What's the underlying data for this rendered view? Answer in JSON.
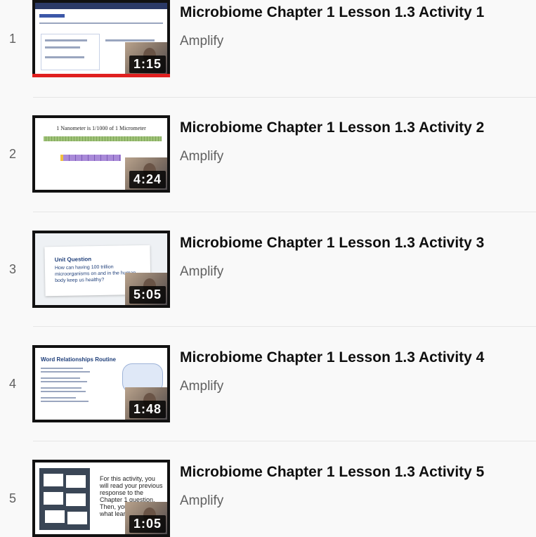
{
  "playlist": {
    "items": [
      {
        "index": "1",
        "title": "Microbiome Chapter 1 Lesson 1.3 Activity 1",
        "channel": "Amplify",
        "duration": "1:15",
        "watched_fraction": 1.0
      },
      {
        "index": "2",
        "title": "Microbiome Chapter 1 Lesson 1.3 Activity 2",
        "channel": "Amplify",
        "duration": "4:24",
        "thumb_title": "1 Nanometer is 1/1000 of 1 Micrometer"
      },
      {
        "index": "3",
        "title": "Microbiome Chapter 1 Lesson 1.3 Activity 3",
        "channel": "Amplify",
        "duration": "5:05",
        "thumb_heading": "Unit Question",
        "thumb_question": "How can having 100 trillion microorganisms on and in the human body keep us healthy?"
      },
      {
        "index": "4",
        "title": "Microbiome Chapter 1 Lesson 1.3 Activity 4",
        "channel": "Amplify",
        "duration": "1:48",
        "thumb_heading": "Word Relationships Routine"
      },
      {
        "index": "5",
        "title": "Microbiome Chapter 1 Lesson 1.3 Activity 5",
        "channel": "Amplify",
        "duration": "1:05",
        "thumb_text": "For this activity, you will read your previous response to the Chapter 1 question. Then, you will include what learned so fa"
      }
    ]
  },
  "colors": {
    "progress": "#e02020",
    "title": "#0f0f0f",
    "secondary": "#606060"
  }
}
